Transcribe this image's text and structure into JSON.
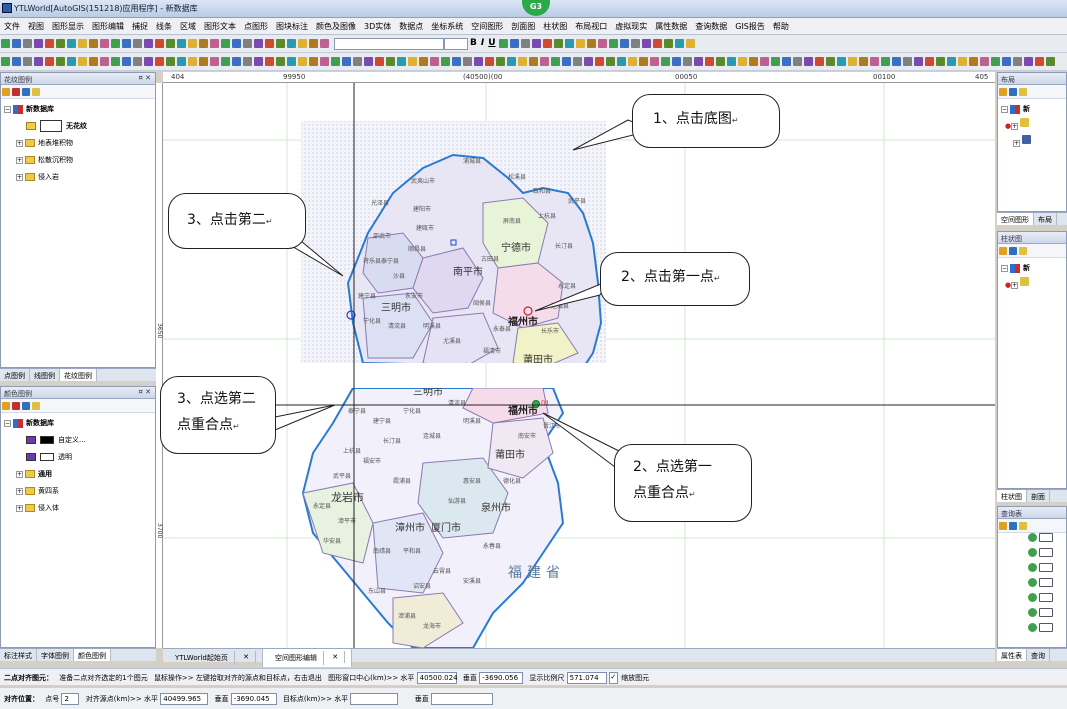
{
  "app": {
    "title": "YTLWorld[AutoGIS(151218)应用程序] - 新数据库",
    "logo": "G3"
  },
  "menu": [
    "文件",
    "视图",
    "图形显示",
    "图形编辑",
    "捕捉",
    "线条",
    "区域",
    "图形文本",
    "点图形",
    "图块标注",
    "颜色及图像",
    "3D实体",
    "数据点",
    "坐标系统",
    "空间图形",
    "剖面图",
    "柱状图",
    "布局视口",
    "虚拟现实",
    "属性数据",
    "查询数据",
    "GIS报告",
    "帮助"
  ],
  "ruler": {
    "h": [
      "404",
      "99950",
      "(40500)(00",
      "00050",
      "00100",
      "405"
    ],
    "v": [
      "3650",
      "3700"
    ]
  },
  "left_top": {
    "title": "花纹图例",
    "root": "新数据库",
    "items": [
      "无花纹",
      "地表堆积物",
      "松散沉积物",
      "侵入岩"
    ],
    "tabs": [
      "点图例",
      "线图例",
      "花纹图例"
    ]
  },
  "left_bottom": {
    "title": "颜色图例",
    "root": "新数据库",
    "items": [
      "自定义...",
      "透明",
      "通用",
      "黄四系",
      "侵入体"
    ],
    "tabs": [
      "标注样式",
      "字体图例",
      "颜色图例"
    ]
  },
  "right": {
    "layout_title": "布局",
    "layout_root": "新",
    "layout_tabs": [
      "空间图形",
      "布局"
    ],
    "column_title": "柱状图",
    "column_tabs": [
      "柱状图",
      "剖面"
    ],
    "query_title": "查询表",
    "query_tabs": [
      "属性表",
      "查询"
    ]
  },
  "doc_tabs": [
    "YTLWorld起始页",
    "空间图形编辑"
  ],
  "map": {
    "province": "福建省",
    "upper_label": "福州市",
    "lower_label": "福州市",
    "point1": "D1",
    "cities": [
      "南平市",
      "三明市",
      "宁德市",
      "福州市",
      "莆田市",
      "泉州市",
      "厦门市",
      "漳州市",
      "龙岩市",
      "三明市"
    ],
    "counties": [
      "浦城县",
      "松溪县",
      "政和县",
      "武夷山市",
      "建阳市",
      "建瓯市",
      "光泽县",
      "邵武市",
      "顺昌县",
      "屏南县",
      "古田县",
      "闽侯县",
      "长乐市",
      "永泰县",
      "福清市",
      "尤溪县",
      "大田县",
      "永安市",
      "沙县",
      "将乐县",
      "泰宁县",
      "建宁县",
      "宁化县",
      "清流县",
      "明溪县",
      "连城县",
      "长汀县",
      "上杭县",
      "武平县",
      "永定县",
      "漳平市",
      "华安县",
      "南靖县",
      "平和县",
      "云霄县",
      "诏安县",
      "东山县",
      "漳浦县",
      "龙海市",
      "安溪县",
      "永春县",
      "德化县",
      "南安市",
      "晋江市",
      "惠安县",
      "仙游县",
      "霞浦县",
      "福安市",
      "寿宁县",
      "周宁县",
      "柘荣县",
      "福鼎市",
      "罗源县",
      "连江县",
      "平潭县"
    ]
  },
  "callouts": {
    "c1": "1、点击底图",
    "c2": "2、点击第一点",
    "c3": "3、点击第二",
    "c4a": "3、点选第二",
    "c4b": "点重合点",
    "c5a": "2、点选第一",
    "c5b": "点重合点",
    "ret": "↵"
  },
  "status": {
    "mode": "二点对齐图元：",
    "hint1": "准备二点对齐选定的1个图元",
    "hint2": "鼠标操作>> 左键拾取对齐的源点和目标点，右击退出",
    "center_label": "图形窗口中心(km)>> 水平",
    "center_x": "40500.024",
    "center_y_label": "垂直",
    "center_y": "-3690.056",
    "scale_label": "显示比例尺",
    "scale": "571.074",
    "zoom_label": "缩放图元"
  },
  "status2": {
    "title": "对齐位置：",
    "ptno_label": "点号",
    "ptno": "2",
    "src_label": "对齐源点(km)>> 水平",
    "src_x": "40499.965",
    "src_y_label": "垂直",
    "src_y": "-3690.045",
    "tgt_label": "目标点(km)>> 水平",
    "tgt_x": "",
    "tgt_y_label": "垂直",
    "tgt_y": ""
  }
}
